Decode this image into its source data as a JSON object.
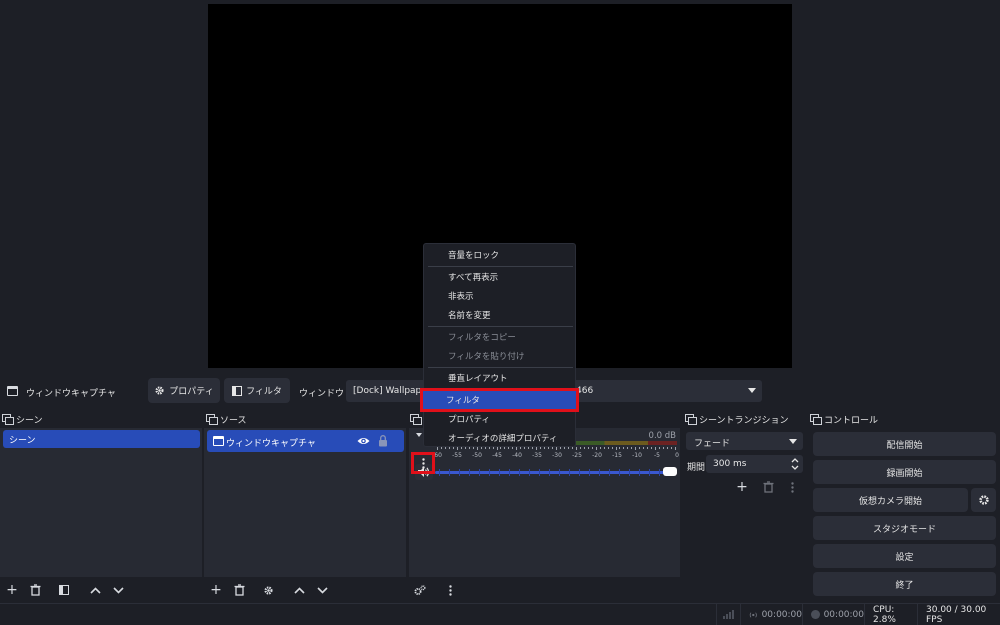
{
  "context_bar": {
    "source_name": "ウィンドウキャプチャ",
    "properties_button": "プロパティ",
    "filters_button": "フィルタ",
    "window_label": "ウィンドウ",
    "window_select_value_left": "[Dock] Wallpaper",
    "window_select_value_right": "466"
  },
  "scenes": {
    "title": "シーン",
    "items": [
      "シーン"
    ]
  },
  "sources": {
    "title": "ソース",
    "items": [
      "ウィンドウキャプチャ"
    ]
  },
  "mixer": {
    "db_value": "0.0 dB",
    "scale": [
      "-60",
      "-55",
      "-50",
      "-45",
      "-40",
      "-35",
      "-30",
      "-25",
      "-20",
      "-15",
      "-10",
      "-5",
      "0"
    ],
    "volume_level": 1.0
  },
  "transitions": {
    "title": "シーントランジション",
    "selected": "フェード",
    "duration_label": "期間",
    "duration_value": "300 ms"
  },
  "controls": {
    "title": "コントロール",
    "start_streaming": "配信開始",
    "start_recording": "録画開始",
    "start_virtual_cam": "仮想カメラ開始",
    "studio_mode": "スタジオモード",
    "settings": "設定",
    "exit": "終了"
  },
  "status": {
    "stream_time": "00:00:00",
    "record_time": "00:00:00",
    "cpu": "CPU: 2.8%",
    "fps": "30.00 / 30.00 FPS"
  },
  "context_menu": {
    "items": [
      {
        "label": "音量をロック",
        "disabled": false
      },
      {
        "label": "すべて再表示",
        "disabled": false
      },
      {
        "label": "非表示",
        "disabled": false
      },
      {
        "label": "名前を変更",
        "disabled": false
      },
      {
        "label": "フィルタをコピー",
        "disabled": true
      },
      {
        "label": "フィルタを貼り付け",
        "disabled": true
      },
      {
        "label": "垂直レイアウト",
        "disabled": false
      },
      {
        "label": "フィルタ",
        "disabled": false,
        "highlighted": true
      },
      {
        "label": "プロパティ",
        "disabled": false
      },
      {
        "label": "オーディオの詳細プロパティ",
        "disabled": false
      }
    ]
  },
  "colors": {
    "accent": "#284cb8",
    "highlight_outline": "#e0101a",
    "background": "#1d1f26",
    "panel": "#272a33"
  }
}
